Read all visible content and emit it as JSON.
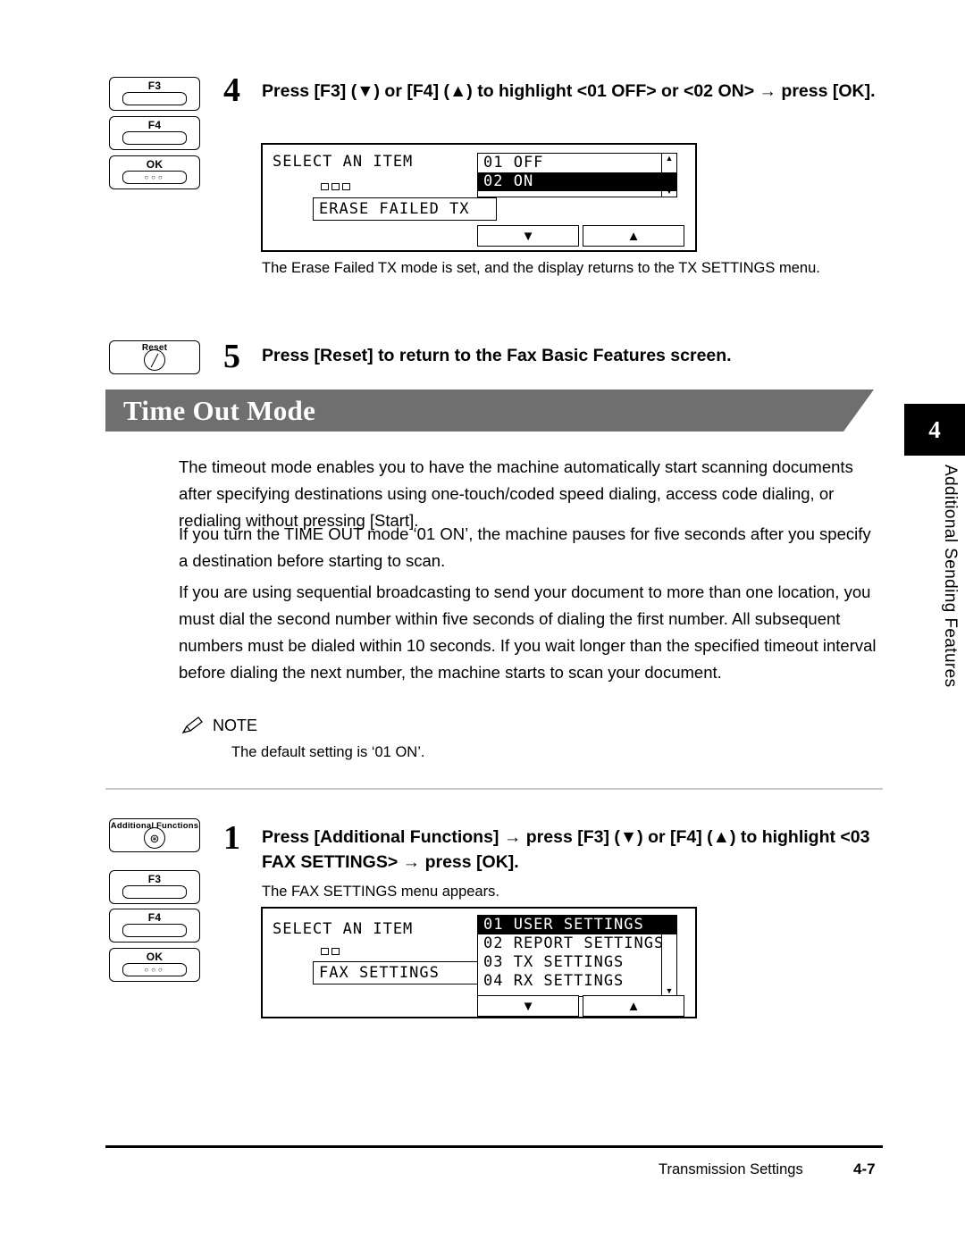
{
  "step4": {
    "number": "4",
    "heading": "Press [F3] (▼) or [F4] (▲) to highlight <01 OFF> or <02 ON> → press [OK].",
    "keys": [
      {
        "label": "F3",
        "name": "key-f3"
      },
      {
        "label": "F4",
        "name": "key-f4"
      },
      {
        "label": "OK",
        "name": "key-ok"
      }
    ],
    "lcd": {
      "title": "SELECT AN ITEM",
      "box_label": "ERASE FAILED TX",
      "items": [
        {
          "text": "01 OFF",
          "selected": false
        },
        {
          "text": "02 ON",
          "selected": true
        }
      ],
      "softkeys": [
        "▼",
        "▲"
      ]
    },
    "caption": "The Erase Failed TX mode is set, and the display returns to the TX SETTINGS menu."
  },
  "step5": {
    "number": "5",
    "heading": "Press [Reset] to return to the Fax Basic Features screen.",
    "key": {
      "label": "Reset",
      "name": "key-reset",
      "glyph": "╱"
    }
  },
  "section": {
    "title": "Time Out Mode",
    "chapter_tab": "4",
    "side_text": "Additional Sending Features",
    "paragraphs": [
      "The timeout mode enables you to have the machine automatically start scanning documents after specifying destinations using one-touch/coded speed dialing, access code dialing, or redialing without pressing [Start].",
      "If you turn the TIME OUT mode ‘01 ON’, the machine pauses for five seconds after you specify a destination before starting to scan.",
      "If you are using sequential broadcasting to send your document to more than one location, you must dial the second number within five seconds of dialing the first number. All subsequent numbers must be dialed within 10 seconds. If you wait longer than the specified timeout interval before dialing the next number, the machine starts to scan your document."
    ],
    "note": {
      "label": "NOTE",
      "text": "The default setting is ‘01 ON’."
    }
  },
  "step1": {
    "number": "1",
    "heading": "Press [Additional Functions] → press [F3] (▼) or [F4] (▲) to highlight <03 FAX SETTINGS> → press [OK].",
    "keys": [
      {
        "label": "Additional Functions",
        "name": "key-additional-functions",
        "glyph": "⊛"
      },
      {
        "label": "F3",
        "name": "key-f3"
      },
      {
        "label": "F4",
        "name": "key-f4"
      },
      {
        "label": "OK",
        "name": "key-ok"
      }
    ],
    "caption": "The FAX SETTINGS menu appears.",
    "lcd": {
      "title": "SELECT AN ITEM",
      "box_label": "FAX SETTINGS",
      "items": [
        {
          "text": "01 USER SETTINGS",
          "selected": true
        },
        {
          "text": "02 REPORT SETTINGS",
          "selected": false
        },
        {
          "text": "03 TX SETTINGS",
          "selected": false
        },
        {
          "text": "04 RX SETTINGS",
          "selected": false
        }
      ],
      "softkeys": [
        "▼",
        "▲"
      ]
    }
  },
  "footer": {
    "left": "Transmission Settings",
    "right": "4-7"
  }
}
